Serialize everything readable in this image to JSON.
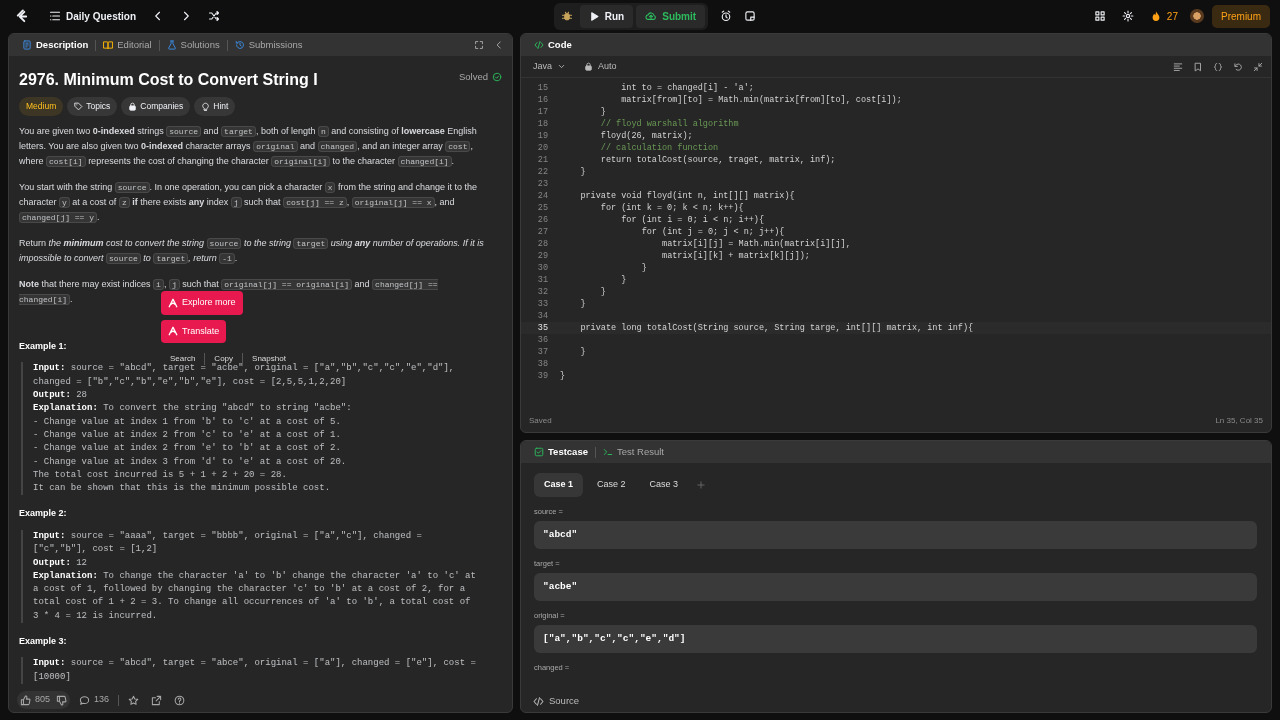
{
  "topbar": {
    "title": "Daily Question",
    "run": "Run",
    "submit": "Submit",
    "streak": "27",
    "premium": "Premium"
  },
  "left_tabs": [
    {
      "label": "Description",
      "selected": true,
      "kind": "description"
    },
    {
      "label": "Editorial",
      "selected": false,
      "kind": "editorial"
    },
    {
      "label": "Solutions",
      "selected": false,
      "kind": "solutions"
    },
    {
      "label": "Submissions",
      "selected": false,
      "kind": "submissions"
    }
  ],
  "problem": {
    "title": "2976. Minimum Cost to Convert String I",
    "status": "Solved",
    "tags": [
      {
        "label": "Medium",
        "kind": "difficulty"
      },
      {
        "label": "Topics",
        "kind": "topics"
      },
      {
        "label": "Companies",
        "kind": "companies"
      },
      {
        "label": "Hint",
        "kind": "hint"
      }
    ],
    "paragraphs": [
      [
        {
          "kind": "text",
          "text": "You are given two **0-indexed** strings "
        },
        {
          "kind": "code",
          "text": "source"
        },
        {
          "kind": "text",
          "text": " and "
        },
        {
          "kind": "code",
          "text": "target"
        },
        {
          "kind": "text",
          "text": ", both of length "
        },
        {
          "kind": "code",
          "text": "n"
        },
        {
          "kind": "text",
          "text": " and consisting of **lowercase** English letters. You are also given two **0-indexed** character arrays "
        },
        {
          "kind": "code",
          "text": "original"
        },
        {
          "kind": "text",
          "text": " and "
        },
        {
          "kind": "code",
          "text": "changed"
        },
        {
          "kind": "text",
          "text": ", and an integer array "
        },
        {
          "kind": "code",
          "text": "cost"
        },
        {
          "kind": "text",
          "text": ", where "
        },
        {
          "kind": "code",
          "text": "cost[i]"
        },
        {
          "kind": "text",
          "text": " represents the cost of changing the character "
        },
        {
          "kind": "code",
          "text": "original[i]"
        },
        {
          "kind": "text",
          "text": " to the character "
        },
        {
          "kind": "code",
          "text": "changed[i]"
        },
        {
          "kind": "text",
          "text": "."
        }
      ],
      [
        {
          "kind": "text",
          "text": "You start with the string "
        },
        {
          "kind": "code",
          "text": "source"
        },
        {
          "kind": "text",
          "text": ". In one operation, you can pick a character "
        },
        {
          "kind": "code",
          "text": "x"
        },
        {
          "kind": "text",
          "text": " from the string and change it to the character "
        },
        {
          "kind": "code",
          "text": "y"
        },
        {
          "kind": "text",
          "text": " at a cost of "
        },
        {
          "kind": "code",
          "text": "z"
        },
        {
          "kind": "text",
          "text": " **if** there exists **any** index "
        },
        {
          "kind": "code",
          "text": "j"
        },
        {
          "kind": "text",
          "text": " such that "
        },
        {
          "kind": "code",
          "text": "cost[j] == z"
        },
        {
          "kind": "text",
          "text": ", "
        },
        {
          "kind": "code",
          "text": "original[j] == x"
        },
        {
          "kind": "text",
          "text": ", and "
        },
        {
          "kind": "code",
          "text": "changed[j] == y"
        },
        {
          "kind": "text",
          "text": "."
        }
      ],
      [
        {
          "kind": "text",
          "text": "Return "
        },
        {
          "kind": "em",
          "text": "the **minimum** cost to convert the string "
        },
        {
          "kind": "code",
          "text": "source"
        },
        {
          "kind": "em",
          "text": " to the string "
        },
        {
          "kind": "code",
          "text": "target"
        },
        {
          "kind": "em",
          "text": " using **any** number of operations. If it is impossible to convert "
        },
        {
          "kind": "code",
          "text": "source"
        },
        {
          "kind": "em",
          "text": " to "
        },
        {
          "kind": "code",
          "text": "target"
        },
        {
          "kind": "em",
          "text": ", return "
        },
        {
          "kind": "code",
          "text": "-1"
        },
        {
          "kind": "text",
          "text": "."
        }
      ],
      [
        {
          "kind": "text",
          "text": "**Note** that there may exist indices "
        },
        {
          "kind": "code",
          "text": "i"
        },
        {
          "kind": "text",
          "text": ", "
        },
        {
          "kind": "code",
          "text": "j"
        },
        {
          "kind": "text",
          "text": " such that "
        },
        {
          "kind": "code",
          "text": "original[j] == original[i]"
        },
        {
          "kind": "text",
          "text": " and "
        },
        {
          "kind": "code",
          "text": "changed[j] == changed[i]"
        },
        {
          "kind": "text",
          "text": "."
        }
      ]
    ],
    "examples": [
      {
        "heading": "Example 1:",
        "lines": [
          {
            "label": "Input:",
            "text": "source = \"abcd\", target = \"acbe\", original = [\"a\",\"b\",\"c\",\"c\",\"e\",\"d\"],"
          },
          {
            "text": "changed = [\"b\",\"c\",\"b\",\"e\",\"b\",\"e\"], cost = [2,5,5,1,2,20]"
          },
          {
            "label": "Output:",
            "text": "28"
          },
          {
            "label": "Explanation:",
            "text": "To convert the string \"abcd\" to string \"acbe\":"
          },
          {
            "text": "- Change value at index 1 from 'b' to 'c' at a cost of 5."
          },
          {
            "text": "- Change value at index 2 from 'c' to 'e' at a cost of 1."
          },
          {
            "text": "- Change value at index 2 from 'e' to 'b' at a cost of 2."
          },
          {
            "text": "- Change value at index 3 from 'd' to 'e' at a cost of 20."
          },
          {
            "text": "The total cost incurred is 5 + 1 + 2 + 20 = 28."
          },
          {
            "text": "It can be shown that this is the minimum possible cost."
          }
        ]
      },
      {
        "heading": "Example 2:",
        "lines": [
          {
            "label": "Input:",
            "text": "source = \"aaaa\", target = \"bbbb\", original = [\"a\",\"c\"], changed ="
          },
          {
            "text": "[\"c\",\"b\"], cost = [1,2]"
          },
          {
            "label": "Output:",
            "text": "12"
          },
          {
            "label": "Explanation:",
            "text": "To change the character 'a' to 'b' change the character 'a' to 'c' at"
          },
          {
            "text": "a cost of 1, followed by changing the character 'c' to 'b' at a cost of 2, for a"
          },
          {
            "text": "total cost of 1 + 2 = 3. To change all occurrences of 'a' to 'b', a total cost of"
          },
          {
            "text": "3 * 4 = 12 is incurred."
          }
        ]
      },
      {
        "heading": "Example 3:",
        "lines": [
          {
            "label": "Input:",
            "text": "source = \"abcd\", target = \"abce\", original = [\"a\"], changed = [\"e\"], cost ="
          },
          {
            "text": "[10000]"
          }
        ]
      }
    ]
  },
  "popup": {
    "buttons": [
      "Explore more",
      "Translate"
    ],
    "actions": [
      "Search",
      "Copy",
      "Snapshot"
    ]
  },
  "footer": {
    "likes": "805",
    "comments": "136"
  },
  "editor": {
    "title": "Code",
    "language": "Java",
    "mode": "Auto",
    "status": "Saved",
    "cursor": "Ln 35, Col 35",
    "lines": [
      {
        "no": "15",
        "text": "            int to = changed[i] - 'a';",
        "kind": "code",
        "current": false
      },
      {
        "no": "16",
        "text": "            matrix[from][to] = Math.min(matrix[from][to], cost[i]);",
        "kind": "code",
        "current": false
      },
      {
        "no": "17",
        "text": "        }",
        "kind": "code",
        "current": false
      },
      {
        "no": "18",
        "text": "        // floyd warshall algorithm",
        "kind": "comment",
        "current": false
      },
      {
        "no": "19",
        "text": "        floyd(26, matrix);",
        "kind": "code",
        "current": false
      },
      {
        "no": "20",
        "text": "        // calculation function",
        "kind": "comment",
        "current": false
      },
      {
        "no": "21",
        "text": "        return totalCost(source, traget, matrix, inf);",
        "kind": "code",
        "current": false
      },
      {
        "no": "22",
        "text": "    }",
        "kind": "code",
        "current": false
      },
      {
        "no": "23",
        "current": false
      },
      {
        "no": "24",
        "text": "    private void floyd(int n, int[][] matrix){",
        "kind": "code",
        "current": false
      },
      {
        "no": "25",
        "text": "        for (int k = 0; k < n; k++){",
        "kind": "code",
        "current": false
      },
      {
        "no": "26",
        "text": "            for (int i = 0; i < n; i++){",
        "kind": "code",
        "current": false
      },
      {
        "no": "27",
        "text": "                for (int j = 0; j < n; j++){",
        "kind": "code",
        "current": false
      },
      {
        "no": "28",
        "text": "                    matrix[i][j] = Math.min(matrix[i][j],",
        "kind": "code",
        "current": false
      },
      {
        "no": "29",
        "text": "                    matrix[i][k] + matrix[k][j]);",
        "kind": "code",
        "current": false
      },
      {
        "no": "30",
        "text": "                }",
        "kind": "code",
        "current": false
      },
      {
        "no": "31",
        "text": "            }",
        "kind": "code",
        "current": false
      },
      {
        "no": "32",
        "text": "        }",
        "kind": "code",
        "current": false
      },
      {
        "no": "33",
        "text": "    }",
        "kind": "code",
        "current": false
      },
      {
        "no": "34",
        "current": false
      },
      {
        "no": "35",
        "text": "    private long totalCost(String source, String targe, int[][] matrix, int inf){",
        "kind": "code",
        "current": true
      },
      {
        "no": "36",
        "current": false
      },
      {
        "no": "37",
        "text": "    }",
        "kind": "code",
        "current": false
      },
      {
        "no": "38",
        "current": false
      },
      {
        "no": "39",
        "text": "}",
        "kind": "code",
        "current": false
      }
    ]
  },
  "testcase": {
    "tabs": [
      {
        "label": "Testcase",
        "selected": true,
        "kind": "testcase"
      },
      {
        "label": "Test Result",
        "selected": false,
        "kind": "result"
      }
    ],
    "cases": [
      {
        "label": "Case 1",
        "selected": true
      },
      {
        "label": "Case 2",
        "selected": false
      },
      {
        "label": "Case 3",
        "selected": false
      }
    ],
    "fields": [
      {
        "label": "source =",
        "value": "\"abcd\""
      },
      {
        "label": "target =",
        "value": "\"acbe\""
      },
      {
        "label": "original =",
        "value": "[\"a\",\"b\",\"c\",\"c\",\"e\",\"d\"]"
      },
      {
        "label": "changed ="
      }
    ],
    "source": "Source"
  }
}
